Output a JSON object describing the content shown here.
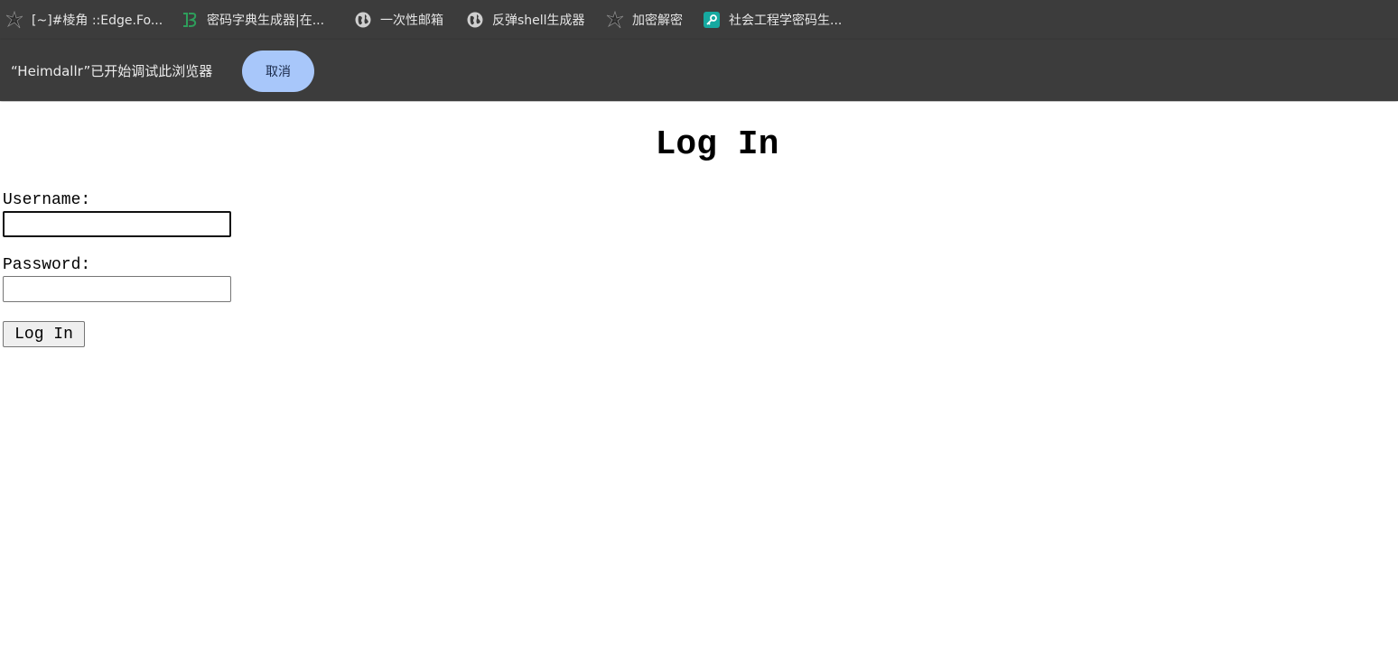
{
  "bookmarks": [
    {
      "label": "[~]#棱角 ::Edge.Fo...",
      "icon": "ninja-star-icon"
    },
    {
      "label": "密码字典生成器|在...",
      "icon": "green-b-logo-icon"
    },
    {
      "label": "一次性邮箱",
      "icon": "globe-icon"
    },
    {
      "label": "反弹shell生成器",
      "icon": "globe-icon"
    },
    {
      "label": "加密解密",
      "icon": "ninja-star-icon"
    },
    {
      "label": "社会工程学密码生...",
      "icon": "key-tile-icon"
    }
  ],
  "infobar": {
    "message": "“Heimdallr”已开始调试此浏览器",
    "cancel_label": "取消",
    "cancel_color": "#a8c7fa"
  },
  "login": {
    "title": "Log In",
    "username_label": "Username:",
    "username_value": "",
    "password_label": "Password:",
    "password_value": "",
    "submit_label": "Log In"
  },
  "colors": {
    "chrome_background": "#3c3c3c",
    "page_background": "#ffffff"
  }
}
